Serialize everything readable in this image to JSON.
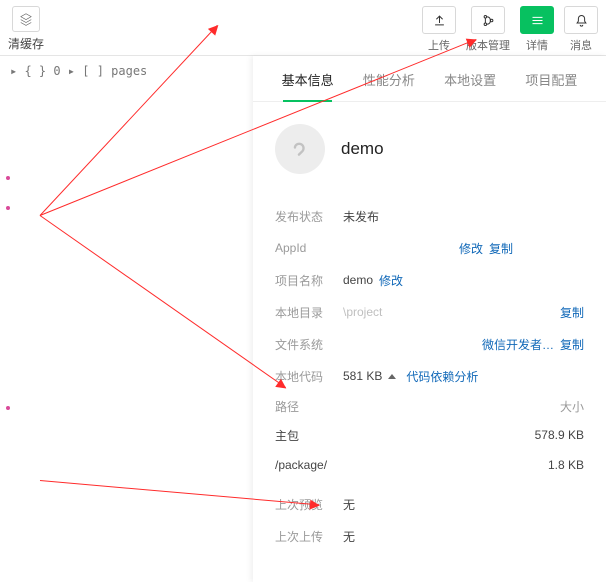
{
  "topbar": {
    "cache_label": "清缓存",
    "actions": {
      "upload": "上传",
      "version": "版本管理",
      "details": "详情",
      "message": "消息"
    }
  },
  "left": {
    "tree_line": "▸ { } 0 ▸ [ ] pages"
  },
  "tabs": {
    "basic": "基本信息",
    "perf": "性能分析",
    "local": "本地设置",
    "project": "项目配置"
  },
  "app": {
    "name": "demo"
  },
  "info": {
    "publish_state_label": "发布状态",
    "publish_state_value": "未发布",
    "appid_label": "AppId",
    "appid_value": "  ",
    "modify": "修改",
    "copy": "复制",
    "project_name_label": "项目名称",
    "project_name_value": "demo",
    "local_dir_label": "本地目录",
    "local_dir_value": "\\project",
    "fs_label": "文件系统",
    "fs_owner": "微信开发者…",
    "code_label": "本地代码",
    "code_size": "581 KB",
    "code_deps": "代码依赖分析"
  },
  "pkg": {
    "path_label": "路径",
    "size_label": "大小",
    "main_label": "主包",
    "main_size": "578.9 KB",
    "sub_label": "/package/",
    "sub_size": "1.8 KB"
  },
  "preview": {
    "last_preview_label": "上次预览",
    "none": "无",
    "last_upload_label": "上次上传"
  }
}
